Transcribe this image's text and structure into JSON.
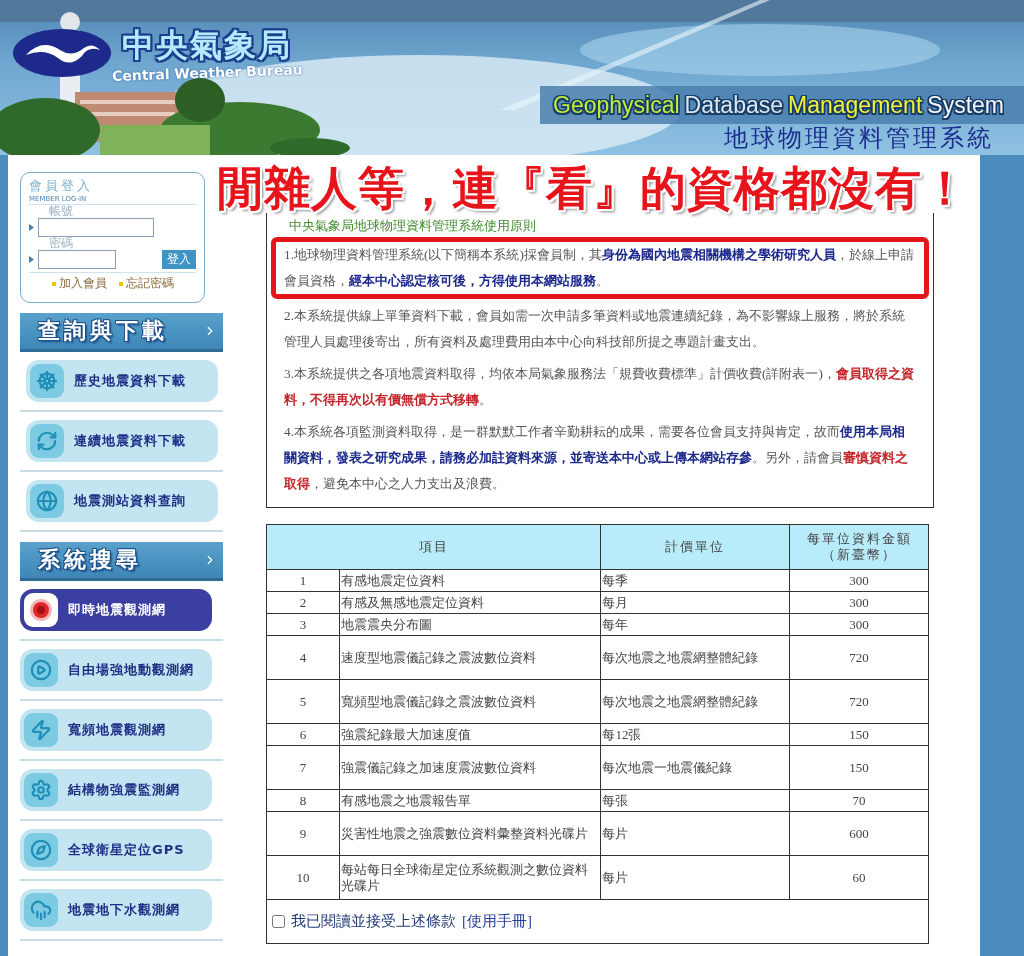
{
  "header": {
    "agency": "中央氣象局",
    "agency_en": "Central Weather Bureau",
    "system_en": [
      "Geophysical",
      "Database",
      "Management",
      "System"
    ],
    "system": "地球物理資料管理系統"
  },
  "overlay_caption": "閒雜人等，連『看』的資格都沒有！",
  "login": {
    "title": "會員登入",
    "subtitle": "MEMBER LOG-IN",
    "account_label": "帳號",
    "password_label": "密碼",
    "button": "登入",
    "links": [
      "加入會員",
      "忘記密碼"
    ]
  },
  "sidebar": [
    {
      "title": "查詢與下載",
      "items": [
        {
          "label": "歷史地震資料下載",
          "kind": "wheel",
          "selected": false
        },
        {
          "label": "連續地震資料下載",
          "kind": "refresh",
          "selected": false
        },
        {
          "label": "地震測站資料查詢",
          "kind": "globe",
          "selected": false
        }
      ]
    },
    {
      "title": "系統搜尋",
      "items": [
        {
          "label": "即時地震觀測網",
          "kind": "target",
          "selected": true
        },
        {
          "label": "自由場強地動觀測網",
          "kind": "play",
          "selected": false
        },
        {
          "label": "寬頻地震觀測網",
          "kind": "bolt",
          "selected": false
        },
        {
          "label": "結構物強震監測網",
          "kind": "gear",
          "selected": false
        },
        {
          "label": "全球衛星定位GPS",
          "kind": "compass",
          "selected": false
        },
        {
          "label": "地震地下水觀測網",
          "kind": "rain",
          "selected": false
        }
      ]
    }
  ],
  "rules": {
    "title": "中央氣象局地球物理資料管理系統使用原則",
    "paragraphs": [
      {
        "boxed": true,
        "segments": [
          {
            "text": "1.地球物理資料管理系統(以下簡稱本系統)採會員制，其"
          },
          {
            "text": "身份為國內地震相關機構之學術研究人員",
            "color": "#1d2a8c"
          },
          {
            "text": "，於線上申請會員資格，"
          },
          {
            "text": "經本中心認定核可後，方得使用本網站服務",
            "color": "#1d2a8c"
          },
          {
            "text": "。"
          }
        ]
      },
      {
        "boxed": false,
        "segments": [
          {
            "text": "2.本系統提供線上單筆資料下載，會員如需一次申請多筆資料或地震連續紀錄，為不影響線上服務，將於系統管理人員處理後寄出，所有資料及處理費用由本中心向科技部所提之專題計畫支出。"
          }
        ]
      },
      {
        "boxed": false,
        "segments": [
          {
            "text": "3.本系統提供之各項地震資料取得，均依本局氣象服務法「規費收費標準」計價收費(詳附表一)，"
          },
          {
            "text": "會員取得之資料，不得再次以有價無償方式移轉",
            "color": "#c4262b"
          },
          {
            "text": "。"
          }
        ]
      },
      {
        "boxed": false,
        "segments": [
          {
            "text": "4.本系統各項監測資料取得，是一群默默工作者辛勤耕耘的成果，需要各位會員支持與肯定，故而"
          },
          {
            "text": "使用本局相關資料，發表之研究成果，請務必加註資料來源，並寄送本中心或上傳本網站存參",
            "color": "#1d2a8c"
          },
          {
            "text": "。另外，請會員"
          },
          {
            "text": "審慎資料之取得",
            "color": "#c4262b"
          },
          {
            "text": "，避免本中心之人力支出及浪費。"
          }
        ]
      }
    ]
  },
  "table": {
    "columns": [
      "項目",
      "計價單位",
      "每單位資料金額（新臺幣）"
    ],
    "rows": [
      {
        "no": "1",
        "item": "有感地震定位資料",
        "unit": "每季",
        "price": "300"
      },
      {
        "no": "2",
        "item": "有感及無感地震定位資料",
        "unit": "每月",
        "price": "300"
      },
      {
        "no": "3",
        "item": "地震震央分布圖",
        "unit": "每年",
        "price": "300"
      },
      {
        "no": "4",
        "item": "速度型地震儀記錄之震波數位資料",
        "unit": "每次地震之地震網整體紀錄",
        "price": "720"
      },
      {
        "no": "5",
        "item": "寬頻型地震儀記錄之震波數位資料",
        "unit": "每次地震之地震網整體紀錄",
        "price": "720"
      },
      {
        "no": "6",
        "item": "強震紀錄最大加速度值",
        "unit": "每12張",
        "price": "150"
      },
      {
        "no": "7",
        "item": "強震儀記錄之加速度震波數位資料",
        "unit": "每次地震一地震儀紀錄",
        "price": "150"
      },
      {
        "no": "8",
        "item": "有感地震之地震報告單",
        "unit": "每張",
        "price": "70"
      },
      {
        "no": "9",
        "item": "災害性地震之強震數位資料彙整資料光碟片",
        "unit": "每片",
        "price": "600"
      },
      {
        "no": "10",
        "item": "每站每日全球衛星定位系統觀測之數位資料光碟片",
        "unit": "每片",
        "price": "60"
      }
    ],
    "agree": {
      "checked": false,
      "label": "我已閱讀並接受上述條款",
      "link": "[使用手冊]"
    }
  }
}
